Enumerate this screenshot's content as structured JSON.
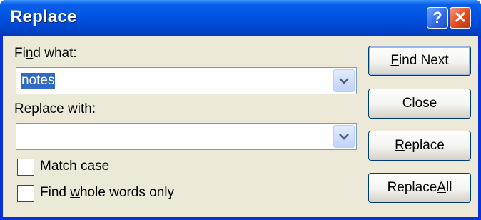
{
  "dialog": {
    "title": "Replace",
    "help_glyph": "?",
    "close_glyph": "✕"
  },
  "find": {
    "label_pre": "Fi",
    "label_key": "n",
    "label_post": "d what:",
    "value": "notes"
  },
  "replace": {
    "label_pre": "Re",
    "label_key": "p",
    "label_post": "lace with:",
    "value": ""
  },
  "options": {
    "match_case": {
      "pre": "Match ",
      "key": "c",
      "post": "ase",
      "checked": false
    },
    "whole_words": {
      "pre": "Find ",
      "key": "w",
      "post": "hole words only",
      "checked": false
    }
  },
  "buttons": {
    "find_next": {
      "pre": "",
      "key": "F",
      "post": "ind Next"
    },
    "close": {
      "pre": "Close",
      "key": "",
      "post": ""
    },
    "replace": {
      "pre": "",
      "key": "R",
      "post": "eplace"
    },
    "replace_all": {
      "pre": "Replace ",
      "key": "A",
      "post": "ll"
    }
  },
  "colors": {
    "titlebar": "#0055e5",
    "client": "#ece9d8",
    "selection": "#316ac5",
    "close_button": "#e04a1d"
  },
  "icons": {
    "help": "help-icon",
    "close": "close-icon",
    "dropdown": "chevron-down-icon"
  }
}
